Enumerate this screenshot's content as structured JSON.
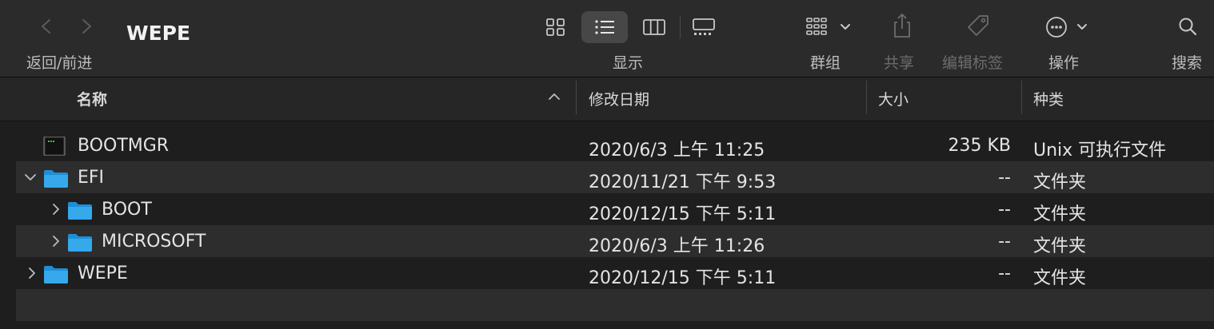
{
  "window": {
    "title": "WEPE"
  },
  "toolbar": {
    "nav_label": "返回/前进",
    "view_label": "显示",
    "group_label": "群组",
    "share_label": "共享",
    "tags_label": "编辑标签",
    "action_label": "操作",
    "search_label": "搜索",
    "active_view": "list"
  },
  "columns": {
    "name": "名称",
    "date": "修改日期",
    "size": "大小",
    "kind": "种类",
    "sort": "ascending"
  },
  "rows": [
    {
      "name": "BOOTMGR",
      "date": "2020/6/3 上午 11:25",
      "size": "235 KB",
      "kind": "Unix 可执行文件",
      "icon": "terminal-executable-icon",
      "level": 0,
      "disclosure": "none"
    },
    {
      "name": "EFI",
      "date": "2020/11/21 下午 9:53",
      "size": "--",
      "kind": "文件夹",
      "icon": "folder-icon",
      "level": 0,
      "disclosure": "expanded"
    },
    {
      "name": "BOOT",
      "date": "2020/12/15 下午 5:11",
      "size": "--",
      "kind": "文件夹",
      "icon": "folder-icon",
      "level": 1,
      "disclosure": "collapsed"
    },
    {
      "name": "MICROSOFT",
      "date": "2020/6/3 上午 11:26",
      "size": "--",
      "kind": "文件夹",
      "icon": "folder-icon",
      "level": 1,
      "disclosure": "collapsed"
    },
    {
      "name": "WEPE",
      "date": "2020/12/15 下午 5:11",
      "size": "--",
      "kind": "文件夹",
      "icon": "folder-icon",
      "level": 0,
      "disclosure": "collapsed"
    }
  ],
  "colors": {
    "background": "#1e1e1e",
    "toolbar": "#2b2b2b",
    "folder": "#2fa3e6",
    "text": "#e4e4e4",
    "dim": "#6d6d6d"
  }
}
